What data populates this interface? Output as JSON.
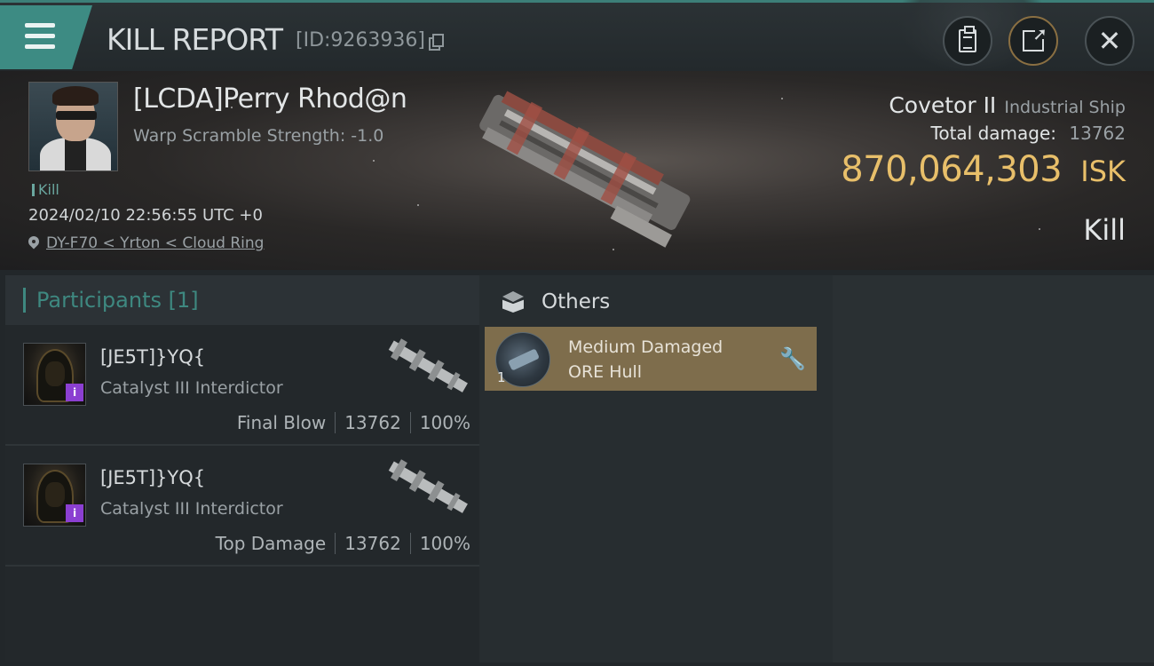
{
  "header": {
    "title": "KILL REPORT",
    "report_id": "[ID:9263936]",
    "buttons": {
      "menu": "menu-icon",
      "report": "clipboard-icon",
      "export": "export-icon",
      "close": "close-icon"
    }
  },
  "kill": {
    "pilot_name": "[LCDA]Perry Rhod@n",
    "warp_scramble": "Warp Scramble Strength: -1.0",
    "tag": "Kill",
    "datetime": "2024/02/10 22:56:55 UTC +0",
    "location": "DY-F70 < Yrton < Cloud Ring",
    "ship_name": "Covetor II",
    "ship_class": "Industrial Ship",
    "total_damage_label": "Total damage:",
    "total_damage_value": "13762",
    "isk_value": "870,064,303",
    "isk_unit": "ISK",
    "result": "Kill"
  },
  "participants": {
    "header": "Participants [1]",
    "rows": [
      {
        "name": "[JE5T]}YQ{",
        "ship": "Catalyst III Interdictor",
        "role": "Final Blow",
        "damage": "13762",
        "percent": "100%"
      },
      {
        "name": "[JE5T]}YQ{",
        "ship": "Catalyst III Interdictor",
        "role": "Top Damage",
        "damage": "13762",
        "percent": "100%"
      }
    ]
  },
  "others": {
    "header": "Others",
    "items": [
      {
        "qty": "1",
        "line1": "Medium Damaged",
        "line2": "ORE Hull"
      }
    ]
  },
  "colors": {
    "accent": "#3d8b83",
    "isk": "#e8bf6a",
    "item_card": "#7e6d4c"
  }
}
